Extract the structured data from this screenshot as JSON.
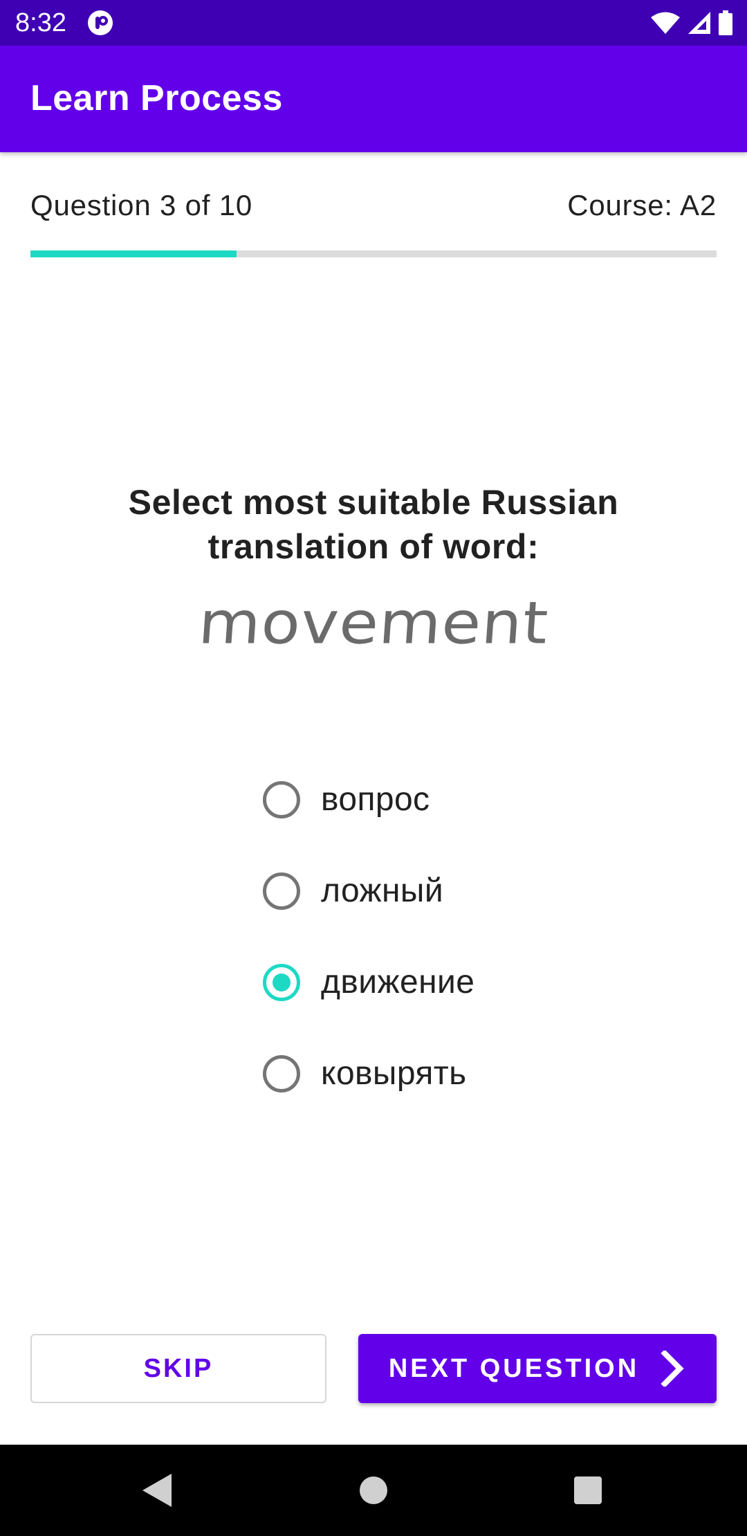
{
  "status_bar": {
    "time": "8:32",
    "notification_icon": "app-notification-icon",
    "icons": [
      "wifi-icon",
      "cellular-signal-icon",
      "battery-icon"
    ]
  },
  "app_bar": {
    "title": "Learn Process"
  },
  "quiz": {
    "counter": "Question 3 of 10",
    "course": "Course: A2",
    "progress": {
      "current": 3,
      "total": 10,
      "fraction": 0.3
    },
    "prompt": "Select most suitable Russian translation of word:",
    "word": "movement",
    "options": [
      {
        "label": "вопрос",
        "selected": false
      },
      {
        "label": "ложный",
        "selected": false
      },
      {
        "label": "движение",
        "selected": true
      },
      {
        "label": "ковырять",
        "selected": false
      }
    ]
  },
  "actions": {
    "skip_label": "SKIP",
    "next_label": "NEXT QUESTION",
    "next_icon": "chevron-right-icon"
  },
  "nav_bar": {
    "icons": [
      "back-icon",
      "home-icon",
      "recents-icon"
    ]
  },
  "colors": {
    "status_bar": "#3f00b4",
    "primary": "#6200ea",
    "accent": "#1dd9c4",
    "track": "#dcdcdc",
    "text": "#212121"
  }
}
